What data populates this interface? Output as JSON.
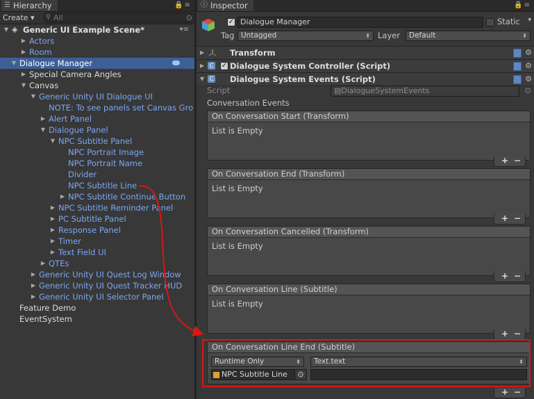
{
  "hierarchy": {
    "tab_label": "Hierarchy",
    "create_label": "Create ▾",
    "search_placeholder": "All",
    "scene_name": "Generic UI Example Scene*",
    "items": [
      {
        "label": "Actors",
        "depth": 1,
        "arrow": "right",
        "color": "blue"
      },
      {
        "label": "Room",
        "depth": 1,
        "arrow": "right",
        "color": "blue"
      },
      {
        "label": "Dialogue Manager",
        "depth": 0,
        "arrow": "down",
        "color": "white",
        "selected": true
      },
      {
        "label": "Special Camera Angles",
        "depth": 1,
        "arrow": "right",
        "color": "white"
      },
      {
        "label": "Canvas",
        "depth": 1,
        "arrow": "down",
        "color": "white"
      },
      {
        "label": "Generic Unity UI Dialogue UI",
        "depth": 2,
        "arrow": "down",
        "color": "blue"
      },
      {
        "label": "NOTE: To see panels set Canvas Gro",
        "depth": 3,
        "arrow": "",
        "color": "blue"
      },
      {
        "label": "Alert Panel",
        "depth": 3,
        "arrow": "right",
        "color": "blue"
      },
      {
        "label": "Dialogue Panel",
        "depth": 3,
        "arrow": "down",
        "color": "blue"
      },
      {
        "label": "NPC Subtitle Panel",
        "depth": 4,
        "arrow": "down",
        "color": "blue"
      },
      {
        "label": "NPC Portrait Image",
        "depth": 5,
        "arrow": "",
        "color": "blue"
      },
      {
        "label": "NPC Portrait Name",
        "depth": 5,
        "arrow": "",
        "color": "blue"
      },
      {
        "label": "Divider",
        "depth": 5,
        "arrow": "",
        "color": "blue"
      },
      {
        "label": "NPC Subtitle Line",
        "depth": 5,
        "arrow": "",
        "color": "blue"
      },
      {
        "label": "NPC Subtitle Continue Button",
        "depth": 5,
        "arrow": "right",
        "color": "blue"
      },
      {
        "label": "NPC Subtitle Reminder Panel",
        "depth": 4,
        "arrow": "right",
        "color": "blue"
      },
      {
        "label": "PC Subtitle Panel",
        "depth": 4,
        "arrow": "right",
        "color": "blue"
      },
      {
        "label": "Response Panel",
        "depth": 4,
        "arrow": "right",
        "color": "blue"
      },
      {
        "label": "Timer",
        "depth": 4,
        "arrow": "right",
        "color": "blue"
      },
      {
        "label": "Text Field UI",
        "depth": 4,
        "arrow": "right",
        "color": "blue"
      },
      {
        "label": "QTEs",
        "depth": 3,
        "arrow": "right",
        "color": "blue"
      },
      {
        "label": "Generic Unity UI Quest Log Window",
        "depth": 2,
        "arrow": "right",
        "color": "blue"
      },
      {
        "label": "Generic Unity UI Quest Tracker HUD",
        "depth": 2,
        "arrow": "right",
        "color": "blue"
      },
      {
        "label": "Generic Unity UI Selector Panel",
        "depth": 2,
        "arrow": "right",
        "color": "blue"
      },
      {
        "label": "Feature Demo",
        "depth": 0,
        "arrow": "",
        "color": "white"
      },
      {
        "label": "EventSystem",
        "depth": 0,
        "arrow": "",
        "color": "white"
      }
    ]
  },
  "inspector": {
    "tab_label": "Inspector",
    "object_name": "Dialogue Manager",
    "static_label": "Static",
    "tag_label": "Tag",
    "tag_value": "Untagged",
    "layer_label": "Layer",
    "layer_value": "Default",
    "components": {
      "transform": "Transform",
      "controller": "Dialogue System Controller (Script)",
      "events": "Dialogue System Events (Script)"
    },
    "script_label": "Script",
    "script_value": "DialogueSystemEvents",
    "section_label": "Conversation Events",
    "events": [
      {
        "header": "On Conversation Start (Transform)",
        "body": "List is Empty"
      },
      {
        "header": "On Conversation End (Transform)",
        "body": "List is Empty"
      },
      {
        "header": "On Conversation Cancelled (Transform)",
        "body": "List is Empty"
      },
      {
        "header": "On Conversation Line (Subtitle)",
        "body": "List is Empty"
      }
    ],
    "line_end_event": {
      "header": "On Conversation Line End (Subtitle)",
      "runtime_value": "Runtime Only",
      "function_value": "Text.text",
      "object_value": "NPC Subtitle Line",
      "arg_value": ""
    },
    "plus": "+",
    "minus": "−"
  },
  "colors": {
    "selection": "#3e5f96",
    "prefab_blue": "#7ba7f2",
    "annotation_red": "#d91616"
  }
}
